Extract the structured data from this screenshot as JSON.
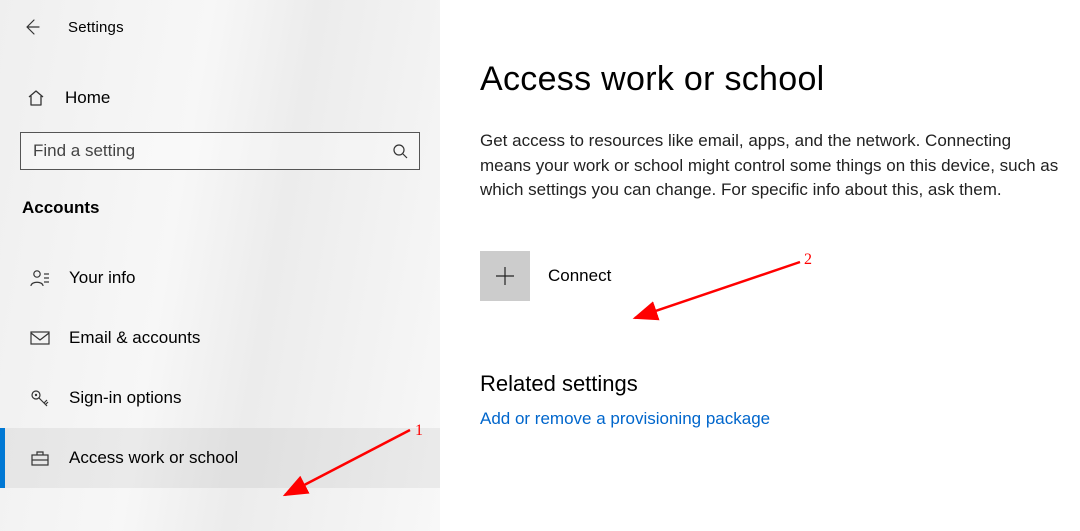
{
  "header": {
    "title": "Settings",
    "home_label": "Home"
  },
  "search": {
    "placeholder": "Find a setting"
  },
  "category": {
    "heading": "Accounts"
  },
  "nav": {
    "items": [
      {
        "label": "Your info",
        "icon": "person-icon"
      },
      {
        "label": "Email & accounts",
        "icon": "mail-icon"
      },
      {
        "label": "Sign-in options",
        "icon": "key-icon"
      },
      {
        "label": "Access work or school",
        "icon": "briefcase-icon"
      }
    ],
    "selected_index": 3
  },
  "main": {
    "title": "Access work or school",
    "description": "Get access to resources like email, apps, and the network. Connecting means your work or school might control some things on this device, such as which settings you can change. For specific info about this, ask them.",
    "connect_label": "Connect",
    "related_heading": "Related settings",
    "related_link": "Add or remove a provisioning package"
  },
  "annotations": {
    "arrow1_label": "1",
    "arrow2_label": "2"
  }
}
